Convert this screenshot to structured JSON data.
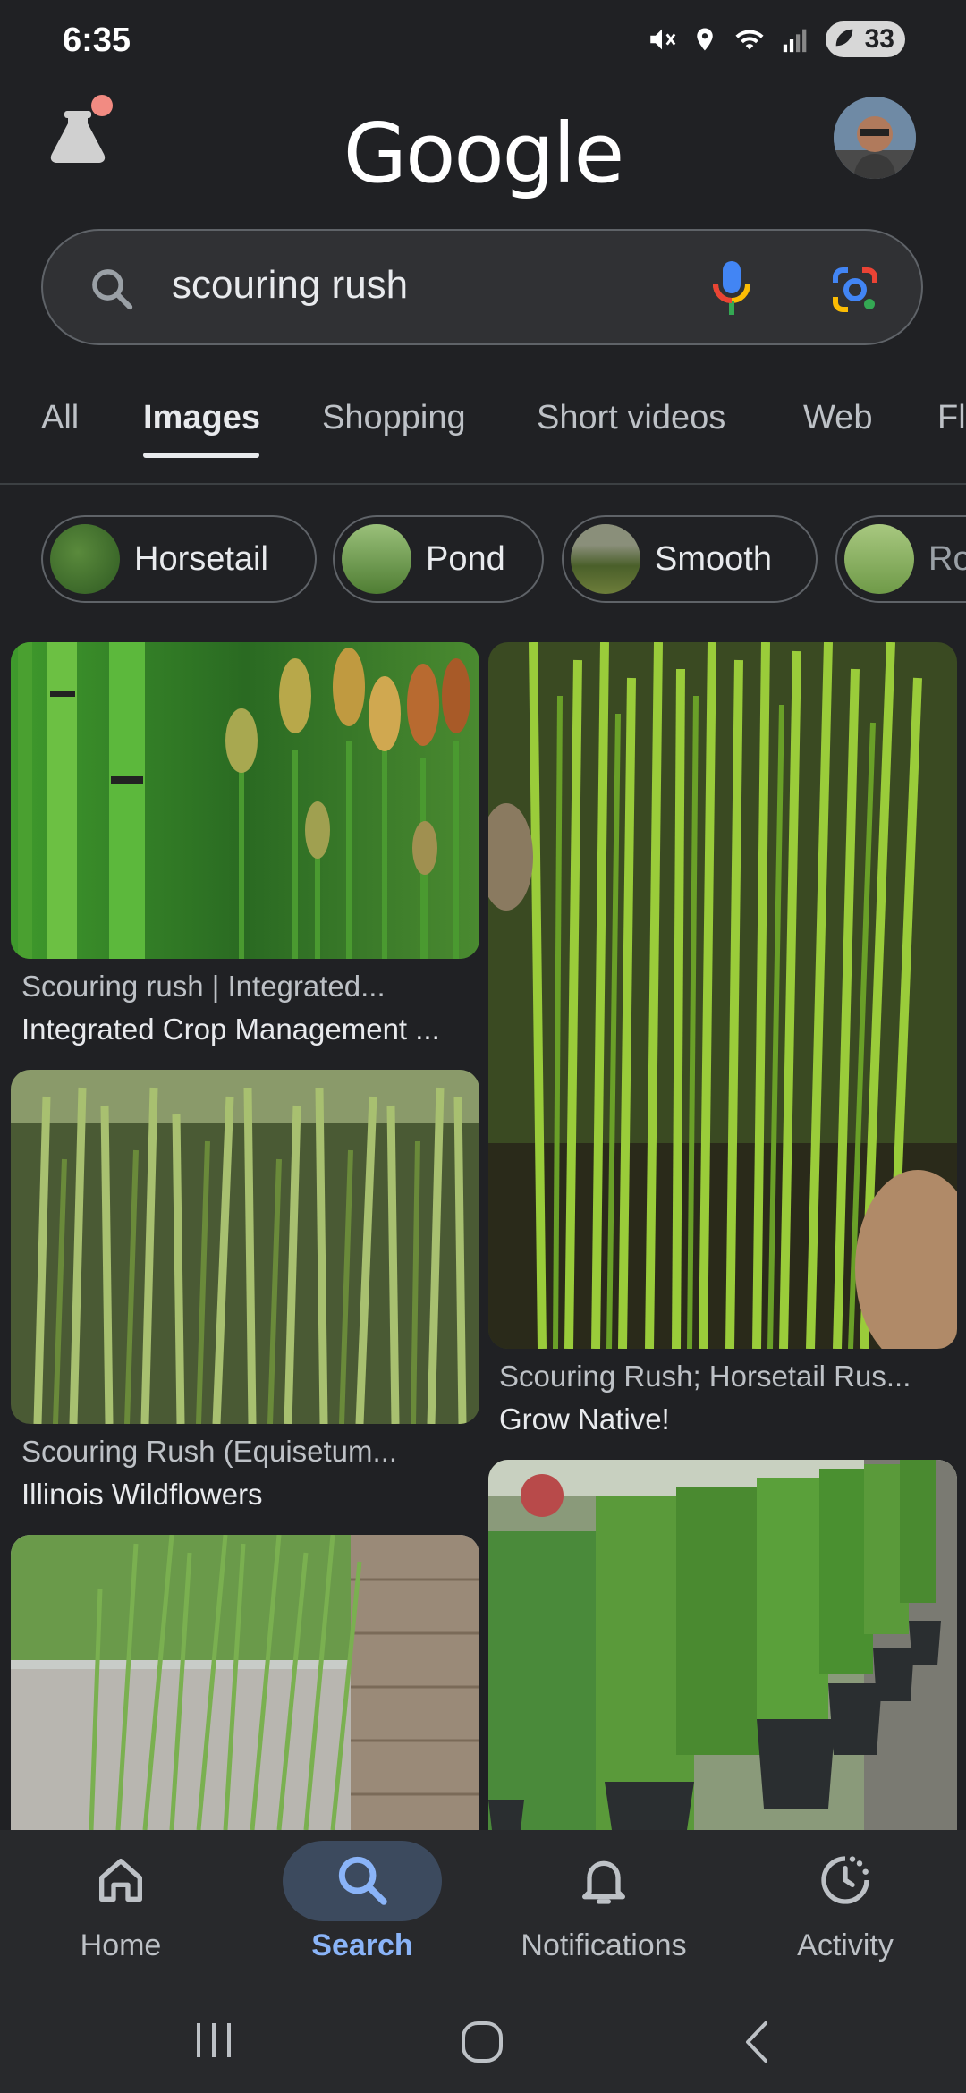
{
  "status_bar": {
    "time": "6:35",
    "battery": "33"
  },
  "header": {
    "logo": "Google"
  },
  "search": {
    "query": "scouring rush"
  },
  "tabs": [
    {
      "label": "All"
    },
    {
      "label": "Images"
    },
    {
      "label": "Shopping"
    },
    {
      "label": "Short videos"
    },
    {
      "label": "Web"
    },
    {
      "label": "Fl"
    }
  ],
  "chips": [
    {
      "label": "Horsetail"
    },
    {
      "label": "Pond"
    },
    {
      "label": "Smooth"
    },
    {
      "label": "Ro"
    }
  ],
  "results": [
    {
      "title": "Scouring rush | Integrated...",
      "source": "Integrated Crop Management ..."
    },
    {
      "title": "Scouring Rush; Horsetail Rus...",
      "source": "Grow Native!"
    },
    {
      "title": "Scouring Rush (Equisetum...",
      "source": "Illinois Wildflowers"
    }
  ],
  "bottom_nav": [
    {
      "label": "Home"
    },
    {
      "label": "Search"
    },
    {
      "label": "Notifications"
    },
    {
      "label": "Activity"
    }
  ],
  "colors": {
    "background": "#202124",
    "accent": "#8ab4f8",
    "surface": "#303134"
  }
}
